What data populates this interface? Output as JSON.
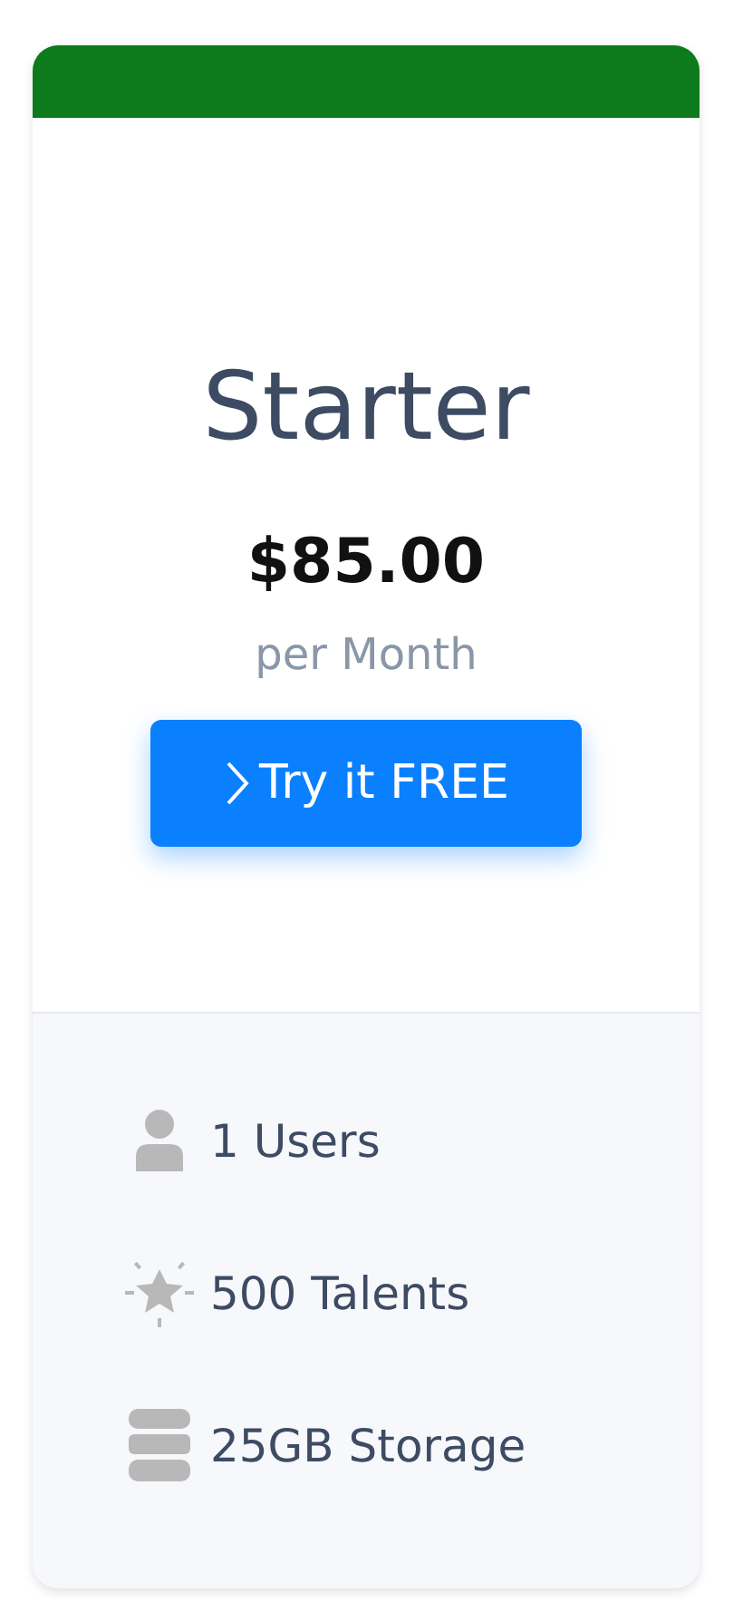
{
  "plan": {
    "name": "Starter",
    "price": "$85.00",
    "period": "per Month",
    "button": "Try it FREE"
  },
  "features": [
    {
      "kind": "user",
      "label": "1 Users"
    },
    {
      "kind": "star",
      "label": "500 Talents"
    },
    {
      "kind": "database",
      "label": "25GB Storage"
    }
  ]
}
